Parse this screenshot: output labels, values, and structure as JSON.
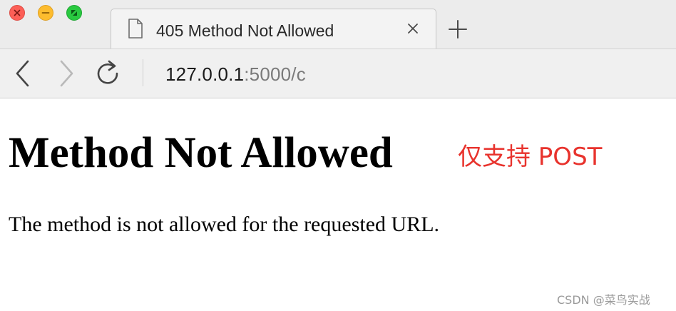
{
  "window": {
    "controls": {
      "close": "close-icon",
      "minimize": "minimize-icon",
      "maximize": "fullscreen-icon"
    }
  },
  "tab": {
    "title": "405 Method Not Allowed",
    "icon": "document-icon",
    "close_icon": "close-icon"
  },
  "new_tab_icon": "plus-icon",
  "toolbar": {
    "back_icon": "chevron-left-icon",
    "forward_icon": "chevron-right-icon",
    "reload_icon": "reload-icon",
    "url_host": "127.0.0.1",
    "url_rest": ":5000/c"
  },
  "page": {
    "heading": "Method Not Allowed",
    "message": "The method is not allowed for the requested URL."
  },
  "annotation": {
    "text": "仅支持 POST",
    "color": "#e8332d"
  },
  "watermark": "CSDN @菜鸟实战"
}
